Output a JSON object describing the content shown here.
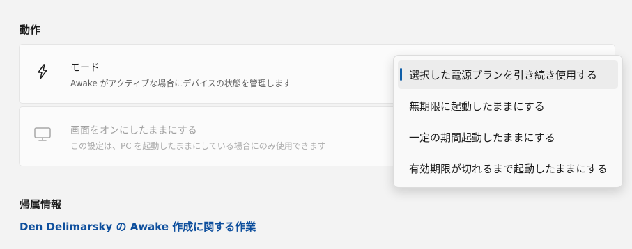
{
  "section": {
    "title": "動作"
  },
  "mode_card": {
    "icon": "lightning-icon",
    "title": "モード",
    "description": "Awake がアクティブな場合にデバイスの状態を管理します"
  },
  "screen_card": {
    "icon": "monitor-icon",
    "title": "画面をオンにしたままにする",
    "description": "この設定は、PC を起動したままにしている場合にのみ使用できます"
  },
  "attribution": {
    "title": "帰属情報",
    "link": "Den Delimarsky の Awake 作成に関する作業"
  },
  "dropdown": {
    "options": [
      "選択した電源プランを引き続き使用する",
      "無期限に起動したままにする",
      "一定の期間起動したままにする",
      "有効期限が切れるまで起動したままにする"
    ],
    "selected": "選択した電源プランを引き続き使用する"
  },
  "colors": {
    "accent": "#0f5ea8",
    "link": "#0e4f9d",
    "background": "#f3f3f3"
  }
}
